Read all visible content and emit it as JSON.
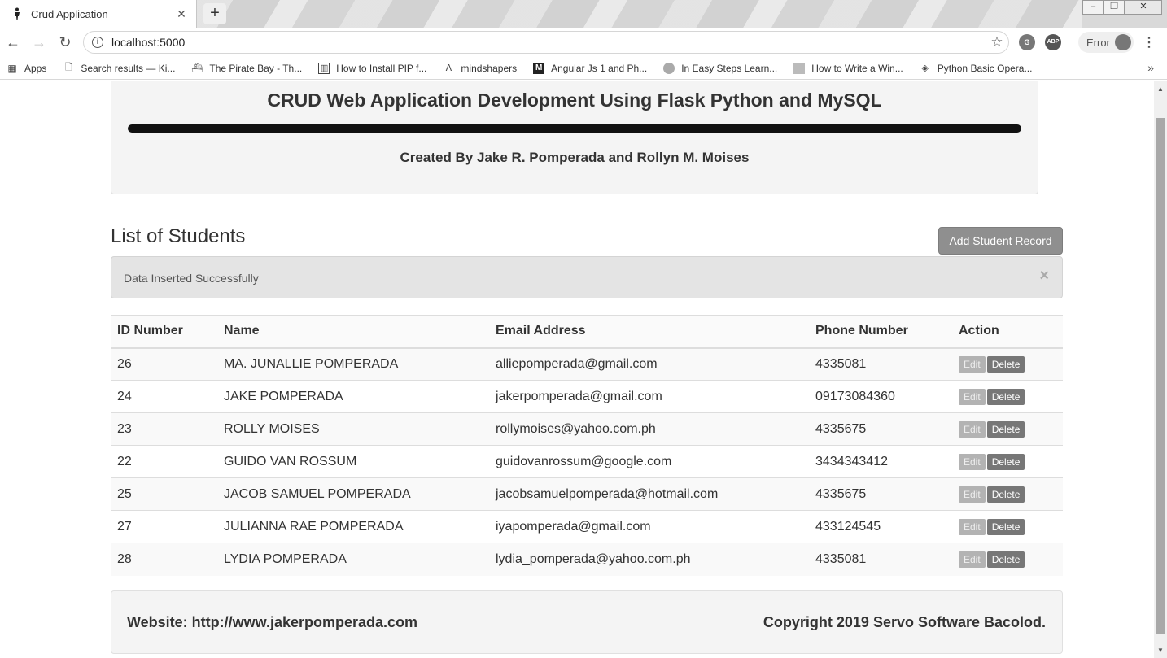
{
  "browser": {
    "tab_title": "Crud Application",
    "tab_close": "✕",
    "new_tab": "+",
    "url": "localhost:5000",
    "profile_label": "Error",
    "bookmarks": [
      {
        "label": "Apps",
        "icon": "apps-grid-icon"
      },
      {
        "label": "Search results — Ki...",
        "icon": "page-icon"
      },
      {
        "label": "The Pirate Bay - Th...",
        "icon": "ship-icon"
      },
      {
        "label": "How to Install PIP f...",
        "icon": "bookmark-icon"
      },
      {
        "label": "mindshapers",
        "icon": "mindshapers-icon"
      },
      {
        "label": "Angular Js 1 and Ph...",
        "icon": "medium-icon"
      },
      {
        "label": "In Easy Steps Learn...",
        "icon": "globe-icon"
      },
      {
        "label": "How to Write a Win...",
        "icon": "puzzle-icon"
      },
      {
        "label": "Python Basic Opera...",
        "icon": "diamond-icon"
      }
    ]
  },
  "header": {
    "title": "CRUD Web Application Development Using Flask Python and MySQL",
    "subtitle": "Created By Jake R. Pomperada and Rollyn M. Moises"
  },
  "main": {
    "list_title": "List of Students",
    "add_button": "Add Student Record",
    "alert_text": "Data Inserted Successfully",
    "alert_close": "×",
    "table": {
      "headers": [
        "ID Number",
        "Name",
        "Email Address",
        "Phone Number",
        "Action"
      ],
      "edit_label": "Edit",
      "delete_label": "Delete",
      "rows": [
        [
          "26",
          "MA. JUNALLIE POMPERADA",
          "alliepomperada@gmail.com",
          "4335081"
        ],
        [
          "24",
          "JAKE POMPERADA",
          "jakerpomperada@gmail.com",
          "09173084360"
        ],
        [
          "23",
          "ROLLY MOISES",
          "rollymoises@yahoo.com.ph",
          "4335675"
        ],
        [
          "22",
          "GUIDO VAN ROSSUM",
          "guidovanrossum@google.com",
          "3434343412"
        ],
        [
          "25",
          "JACOB SAMUEL POMPERADA",
          "jacobsamuelpomperada@hotmail.com",
          "4335675"
        ],
        [
          "27",
          "JULIANNA RAE POMPERADA",
          "iyapomperada@gmail.com",
          "433124545"
        ],
        [
          "28",
          "LYDIA POMPERADA",
          "lydia_pomperada@yahoo.com.ph",
          "4335081"
        ]
      ]
    }
  },
  "footer": {
    "website": "Website: http://www.jakerpomperada.com",
    "copyright": "Copyright 2019 Servo Software Bacolod."
  }
}
